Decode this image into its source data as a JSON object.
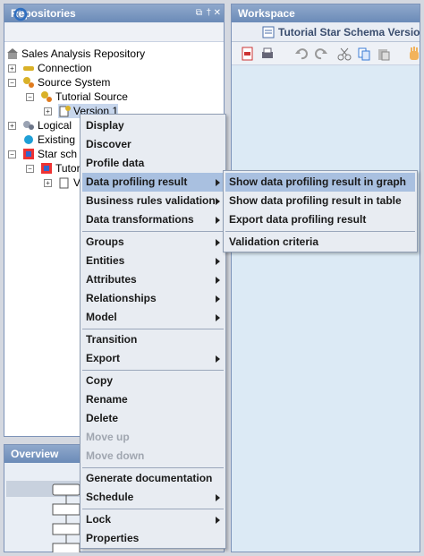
{
  "repositories": {
    "title": "Repositories",
    "controls": [
      "⧉",
      "†",
      "✕"
    ]
  },
  "tree": {
    "root": "Sales Analysis Repository",
    "connection": "Connection",
    "source_system": "Source System",
    "tutorial_source": "Tutorial Source",
    "version": "Version 1",
    "logical": "Logical",
    "existing": "Existing",
    "star": "Star sch",
    "tutorial2": "Tutori",
    "v2": "V"
  },
  "workspace": {
    "title": "Workspace",
    "tab_label": "Tutorial Star Schema Versio"
  },
  "overview": {
    "title": "Overview"
  },
  "context_menu": {
    "items": {
      "display": "Display",
      "discover": "Discover",
      "profile_data": "Profile data",
      "data_profiling_result": "Data profiling result",
      "business_rules_validation": "Business rules validation",
      "data_transformations": "Data transformations",
      "groups": "Groups",
      "entities": "Entities",
      "attributes": "Attributes",
      "relationships": "Relationships",
      "model": "Model",
      "transition": "Transition",
      "export": "Export",
      "copy": "Copy",
      "rename": "Rename",
      "delete": "Delete",
      "move_up": "Move up",
      "move_down": "Move down",
      "generate_documentation": "Generate documentation",
      "schedule": "Schedule",
      "lock": "Lock",
      "properties": "Properties"
    }
  },
  "submenu": {
    "show_graph": "Show data profiling result in graph",
    "show_table": "Show data profiling result in table",
    "export_result": "Export data profiling result",
    "validation_criteria": "Validation criteria"
  },
  "colors": {
    "accent": "#6b8bb8",
    "highlight": "#a9c0e0",
    "menu_bg": "#e8ecf2"
  }
}
